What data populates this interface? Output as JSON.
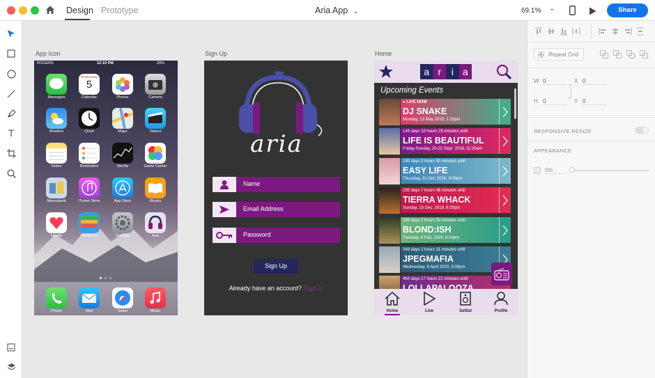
{
  "window": {
    "tabs": [
      "Design",
      "Prototype"
    ],
    "title": "Aria App",
    "zoom": "69.1%",
    "share_label": "Share"
  },
  "artboards": {
    "app_icon": "App Icon",
    "sign_up": "Sign Up",
    "home": "Home"
  },
  "iphone": {
    "carrier": "ROGERS",
    "time": "12:19 PM",
    "battery": "29%",
    "calendar_day": "Wednesday",
    "calendar_date": "5",
    "apps": [
      "Messages",
      "Calendar",
      "Photos",
      "Camera",
      "Weather",
      "Clock",
      "Maps",
      "Videos",
      "Notes",
      "Reminders",
      "Stocks",
      "Game Center",
      "Newsstand",
      "iTunes Store",
      "App Store",
      "iBooks",
      "Health",
      "Passbook",
      "Settings",
      "Aria"
    ],
    "dock": [
      "Phone",
      "Mail",
      "Safari",
      "Music"
    ]
  },
  "signup": {
    "logo_text": "aria",
    "name_placeholder": "Name",
    "email_placeholder": "Email Address",
    "password_placeholder": "Password",
    "button_label": "Sign Up",
    "have_account": "Already have an account?",
    "sign_in_link": "Sign In"
  },
  "home": {
    "logo_letters": [
      "a",
      "r",
      "i",
      "a"
    ],
    "section_title": "Upcoming Events",
    "events": [
      {
        "meta": "● LIVE NOW",
        "title": "DJ SNAKE",
        "date": "Monday, 13 May 2019, 1:20pm",
        "c1": "#e23a6a",
        "c2": "#3bb38a"
      },
      {
        "meta": "148 days 18 hours 29 minutes until",
        "title": "LIFE IS BEAUTIFUL",
        "date": "Friday-Sunday, 20-22 Sept. 2019, 11:30am",
        "c1": "#7a1a8c",
        "c2": "#e0295f"
      },
      {
        "meta": "190 days 3 hours 50 minutes until",
        "title": "EASY LIFE",
        "date": "Thursday, 31 Oct. 2019, 9:00pm",
        "c1": "#3c86b8",
        "c2": "#7fb8c9"
      },
      {
        "meta": "235 days 7 hours 46 minutes until",
        "title": "TIERRA WHACK",
        "date": "Sunday, 15 Dec. 2019, 6:30pm",
        "c1": "#c0184f",
        "c2": "#e22c54"
      },
      {
        "meta": "288 days 3 hours 50 minutes until",
        "title": "BLOND:ISH",
        "date": "Tuesday, 4 Feb. 2020, 8:00pm",
        "c1": "#6eb27a",
        "c2": "#2a9d88"
      },
      {
        "meta": "349 days 2 hours 11 minutes until",
        "title": "JPEGMAFIA",
        "date": "Wednesday, 8 April 2020, 5:00pm",
        "c1": "#2e5a78",
        "c2": "#3a7f95"
      },
      {
        "meta": "464 days 17 hours 21 minutes until",
        "title": "LOLLAPALOOZA",
        "date": "",
        "c1": "#6a2c8e",
        "c2": "#b8306a"
      }
    ],
    "nav": [
      "Home",
      "Live",
      "Setlist",
      "Profile"
    ]
  },
  "inspector": {
    "repeat_grid": "Repeat Grid",
    "w_label": "W",
    "w_value": "0",
    "x_label": "X",
    "x_value": "0",
    "h_label": "H",
    "h_value": "0",
    "y_label": "Y",
    "y_value": "0",
    "responsive_resize": "RESPONSIVE RESIZE",
    "appearance": "APPEARANCE",
    "opacity": "0%"
  },
  "colors": {
    "accent": "#1473e6",
    "purple": "#7b1a7e",
    "navy": "#25265e"
  }
}
